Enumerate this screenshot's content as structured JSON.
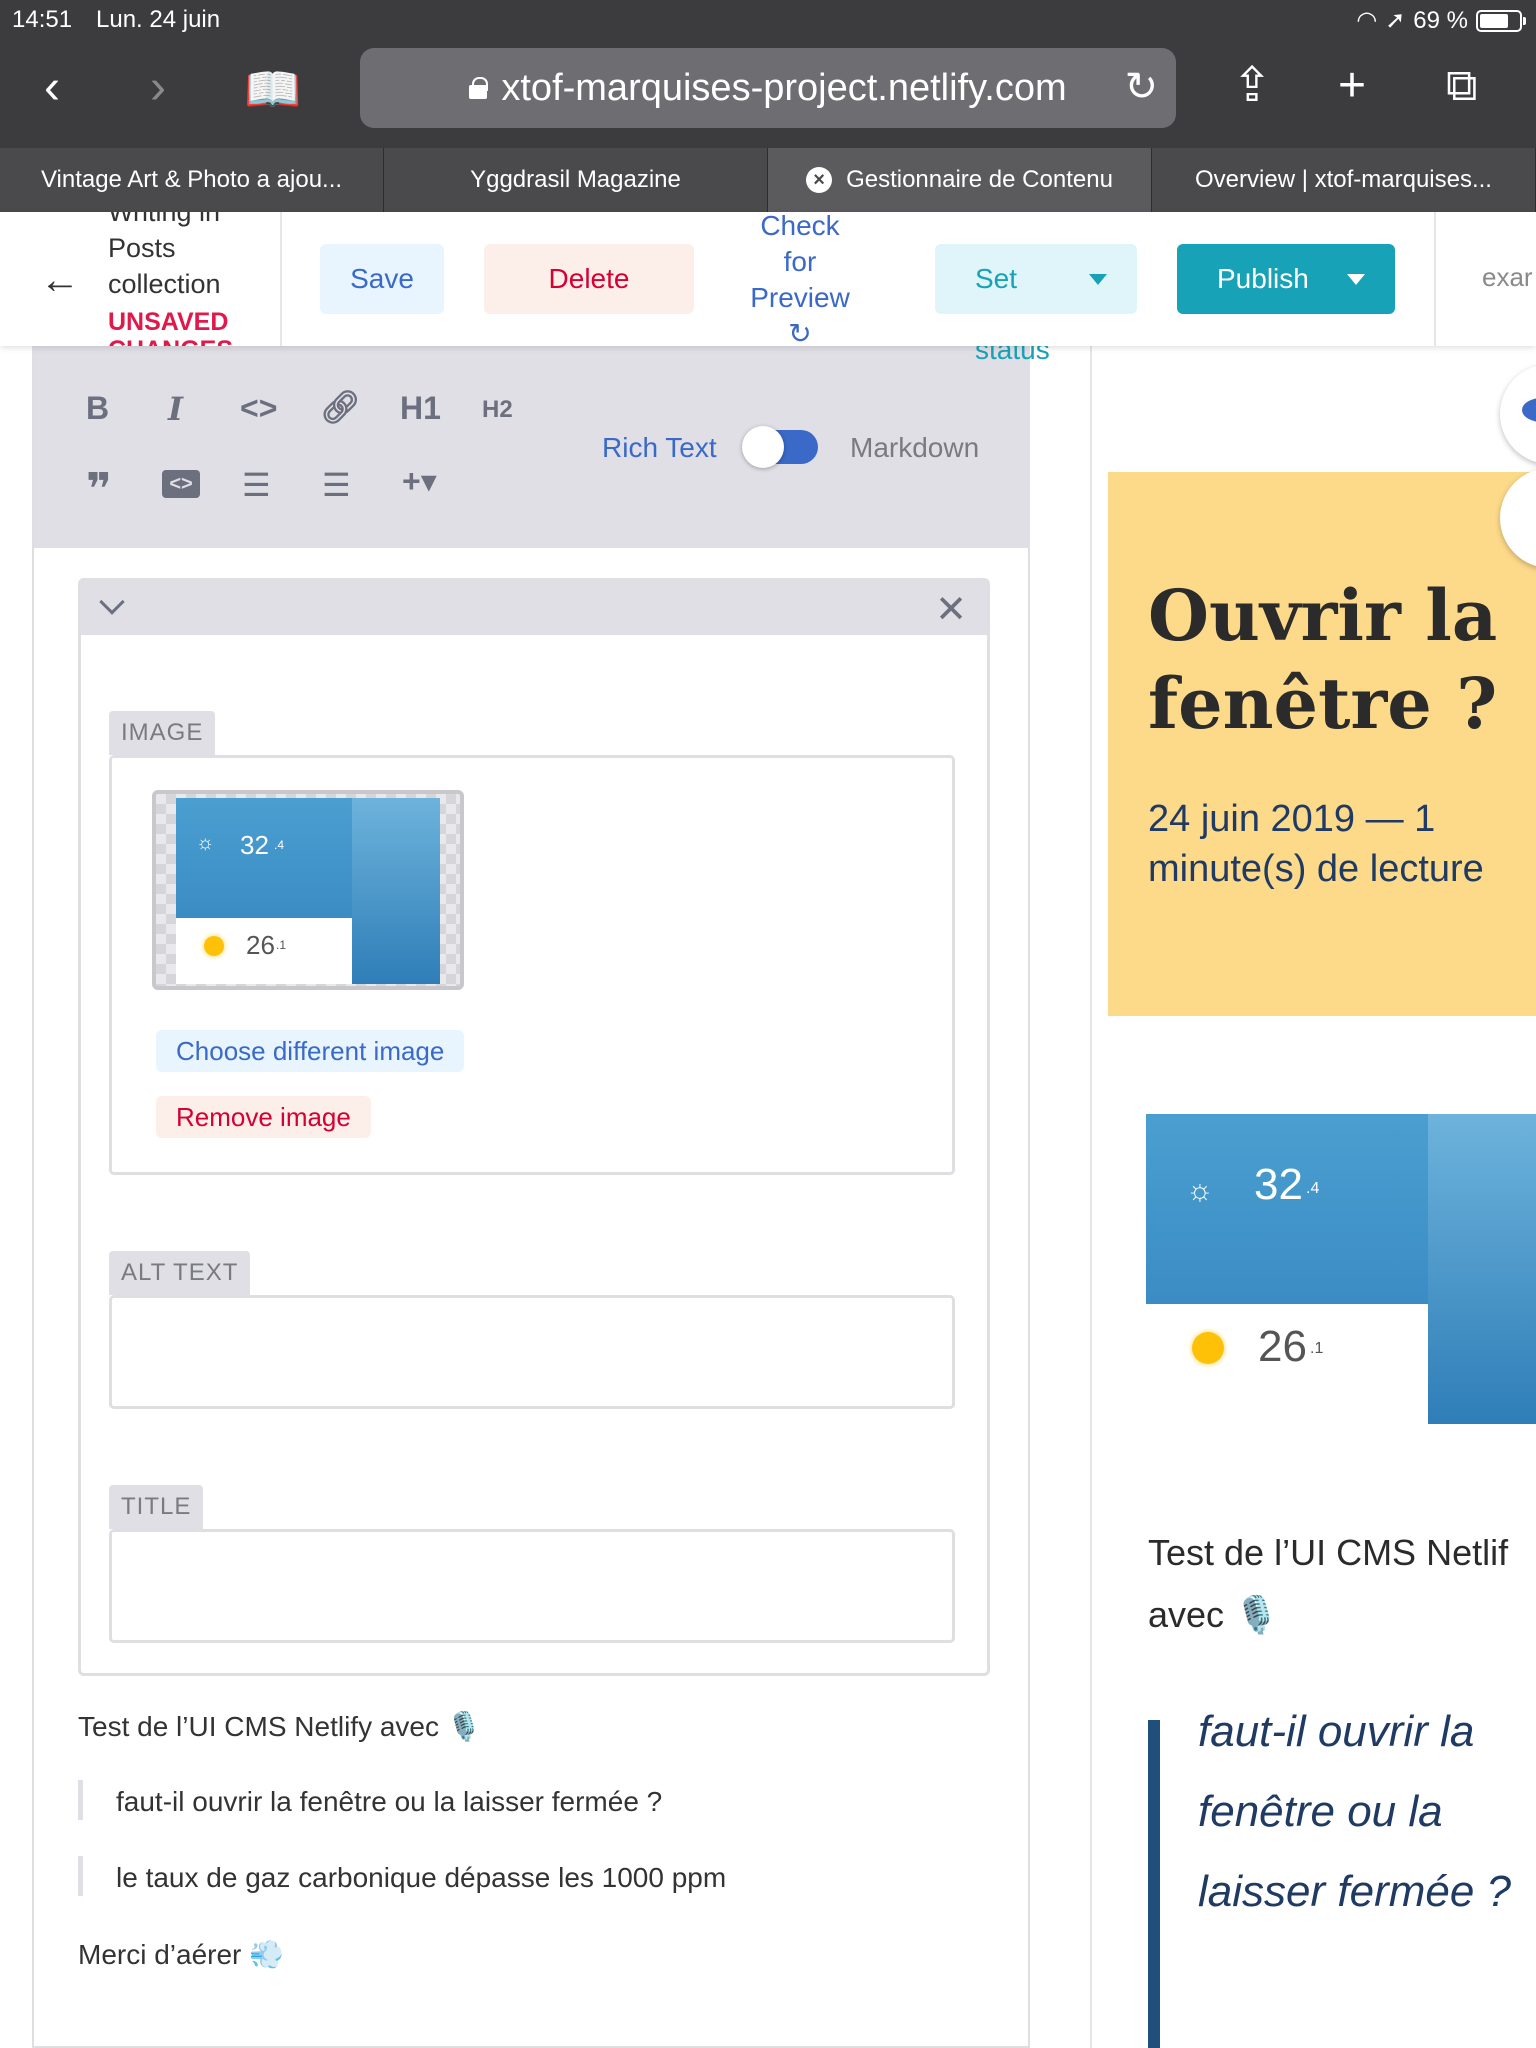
{
  "status_bar": {
    "time": "14:51",
    "date": "Lun. 24 juin",
    "battery": "69 %"
  },
  "browser": {
    "url": "xtof-marquises-project.netlify.com",
    "tabs": [
      {
        "label": "Vintage Art & Photo a ajou..."
      },
      {
        "label": "Yggdrasil Magazine"
      },
      {
        "label": "Gestionnaire de Contenu"
      },
      {
        "label": "Overview | xtof-marquises..."
      }
    ]
  },
  "cms_header": {
    "collection_line1": "Writing in",
    "collection_line2": "Posts",
    "collection_line3": "collection",
    "unsaved_line1": "UNSAVED",
    "unsaved_line2": "CHANGES",
    "save": "Save",
    "delete": "Delete",
    "check_line1": "Check",
    "check_line2": "for",
    "check_line3": "Preview",
    "set": "Set",
    "status": "status",
    "publish": "Publish",
    "example": "exar"
  },
  "editor": {
    "toolbar": {
      "bold": "B",
      "italic": "I",
      "code": "<>",
      "heading1": "H1",
      "heading2": "H2",
      "rich_text": "Rich Text",
      "markdown": "Markdown",
      "mode": "rich"
    },
    "image_widget": {
      "image_label": "IMAGE",
      "choose": "Choose different image",
      "remove": "Remove image",
      "alt_label": "ALT TEXT",
      "alt_value": "",
      "title_label": "TITLE",
      "title_value": ""
    },
    "weather_thumbnail": {
      "temp_main": "32",
      "temp_main_decimal": ".4",
      "temp_second": "26",
      "temp_second_decimal": ".1"
    },
    "body": {
      "paragraph1": "Test de l’UI CMS Netlify avec 🎙️",
      "quote1": "faut-il ouvrir la fenêtre ou la laisser fermée ?",
      "quote2": "le taux de gaz carbonique dépasse les 1000 ppm",
      "paragraph2": "Merci d’aérer 💨"
    }
  },
  "preview": {
    "title": "Ouvrir la fenêtre ?",
    "meta": "24 juin 2019 — 1 minute(s) de lecture",
    "text_line1": "Test de l’UI CMS Netlif",
    "text_line2": "avec 🎙️",
    "quote": "faut-il ouvrir la fenêtre ou la laisser fermée ?"
  },
  "colors": {
    "accent": "#3a69c7",
    "danger": "#d60032",
    "teal": "#17a2b8",
    "hero": "#fdd98a"
  }
}
